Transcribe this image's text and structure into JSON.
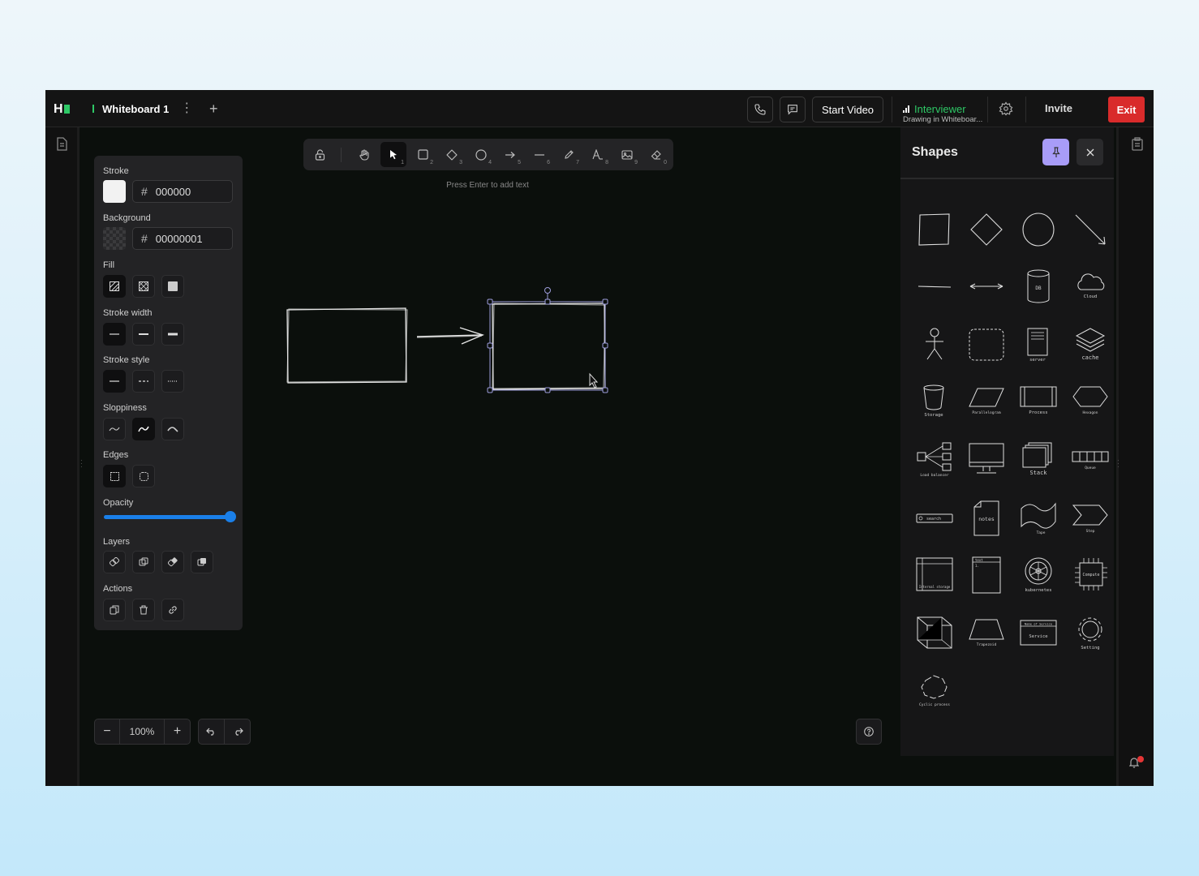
{
  "header": {
    "logo_letter": "H",
    "tab_label": "Whiteboard 1",
    "start_video_label": "Start Video",
    "interviewer_name": "Interviewer",
    "interviewer_status": "Drawing in Whiteboar...",
    "invite_label": "Invite",
    "exit_label": "Exit",
    "brand_color": "#2ec866",
    "exit_color": "#d92b2b"
  },
  "properties": {
    "stroke_label": "Stroke",
    "stroke_hex": "000000",
    "background_label": "Background",
    "background_hex": "00000001",
    "hash": "#",
    "fill_label": "Fill",
    "stroke_width_label": "Stroke width",
    "stroke_style_label": "Stroke style",
    "sloppiness_label": "Sloppiness",
    "edges_label": "Edges",
    "opacity_label": "Opacity",
    "opacity_value": 1.0,
    "layers_label": "Layers",
    "actions_label": "Actions"
  },
  "toolbar": {
    "tools": [
      {
        "icon": "lock-icon",
        "key": ""
      },
      {
        "icon": "hand-icon",
        "key": ""
      },
      {
        "icon": "pointer-icon",
        "key": "1",
        "active": true
      },
      {
        "icon": "rectangle-icon",
        "key": "2"
      },
      {
        "icon": "diamond-icon",
        "key": "3"
      },
      {
        "icon": "ellipse-icon",
        "key": "4"
      },
      {
        "icon": "arrow-icon",
        "key": "5"
      },
      {
        "icon": "line-icon",
        "key": "6"
      },
      {
        "icon": "pencil-icon",
        "key": "7"
      },
      {
        "icon": "text-icon",
        "key": "8"
      },
      {
        "icon": "image-icon",
        "key": "9"
      },
      {
        "icon": "eraser-icon",
        "key": "0"
      }
    ],
    "hint": "Press Enter to add text"
  },
  "zoom": {
    "minus": "−",
    "level": "100%",
    "plus": "+"
  },
  "shapes_panel": {
    "title": "Shapes",
    "labels": {
      "db": "DB",
      "cloud": "Cloud",
      "server": "server",
      "cache": "cache",
      "storage": "Storage",
      "parallelogram": "Parallelogram",
      "process": "Process",
      "hexagon": "Hexagon",
      "load_balancer": "Load balancer",
      "stack": "Stack",
      "queue": "Queue",
      "search": "search",
      "notes": "notes",
      "tape": "Tape",
      "step": "Step",
      "internal_storage": "Internal storage",
      "text": "text",
      "kubernetes": "kubernetes",
      "compute": "Compute",
      "trapezoid": "Trapezoid",
      "name_of_service": "Name of Service",
      "service": "Service",
      "setting": "Setting",
      "cyclic_process": "Cyclic process"
    }
  },
  "notifications": {
    "count": "1"
  }
}
